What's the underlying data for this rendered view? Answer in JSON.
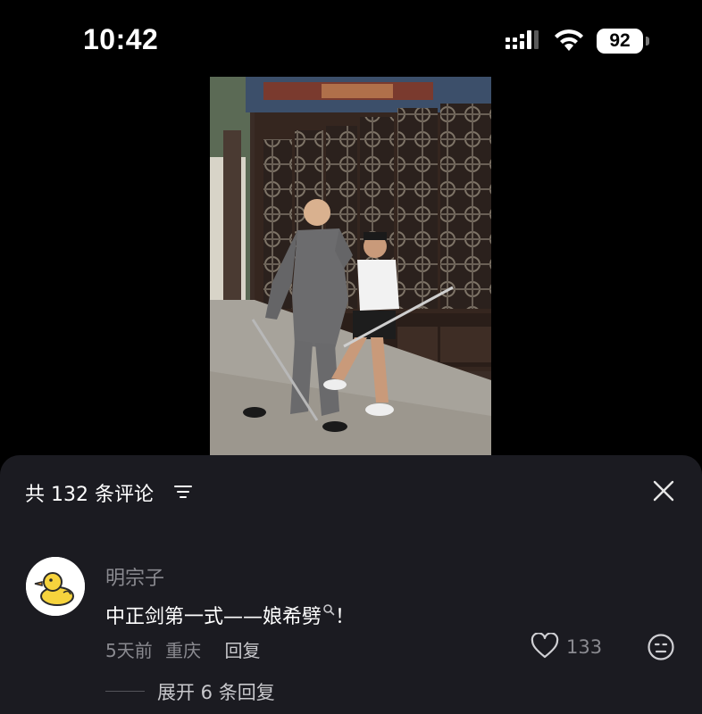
{
  "status_bar": {
    "time": "10:42",
    "battery_level": "92",
    "icons": [
      "signal-icon",
      "wifi-icon",
      "battery-icon"
    ]
  },
  "video": {
    "thumbnail": "two-men-sword-demo-frame"
  },
  "comments": {
    "header": "共 132 条评论",
    "sort_icon": "sort-icon",
    "close_icon": "close-icon",
    "items": [
      {
        "avatar_icon": "duck-avatar-icon",
        "username": "明宗子",
        "text": "中正剑第一式——娘希劈",
        "suffix": "！",
        "time": "5天前",
        "location": "重庆",
        "reply_label": "回复",
        "likes": "133",
        "expand_label": "展开 6 条回复"
      }
    ]
  },
  "colors": {
    "sheet_bg": "#1b1b21",
    "muted_text": "#8a8a90",
    "primary_text": "#ffffff"
  }
}
